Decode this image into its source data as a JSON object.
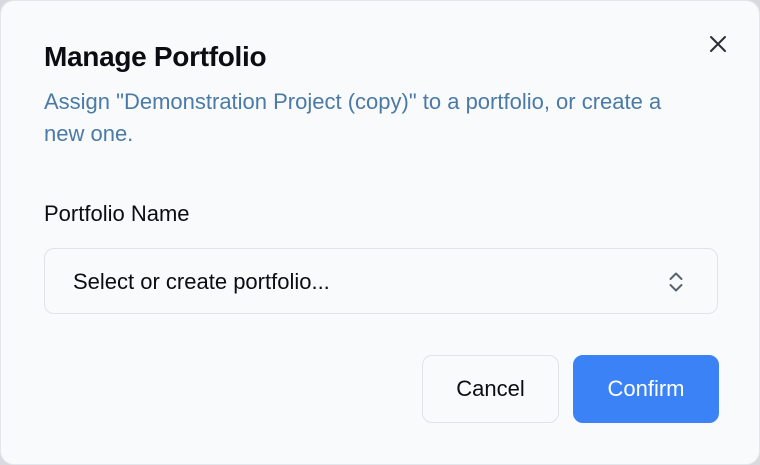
{
  "dialog": {
    "title": "Manage Portfolio",
    "subtitle": "Assign \"Demonstration Project (copy)\" to a portfolio, or create a new one.",
    "close_icon": "close-icon"
  },
  "form": {
    "portfolio_label": "Portfolio Name",
    "portfolio_select": {
      "placeholder": "Select or create portfolio...",
      "icon": "chevron-up-down-icon"
    }
  },
  "actions": {
    "cancel_label": "Cancel",
    "confirm_label": "Confirm"
  },
  "colors": {
    "accent": "#3b82f6",
    "subtitle_text": "#4b7aa6",
    "dialog_background": "#f8fafc"
  }
}
